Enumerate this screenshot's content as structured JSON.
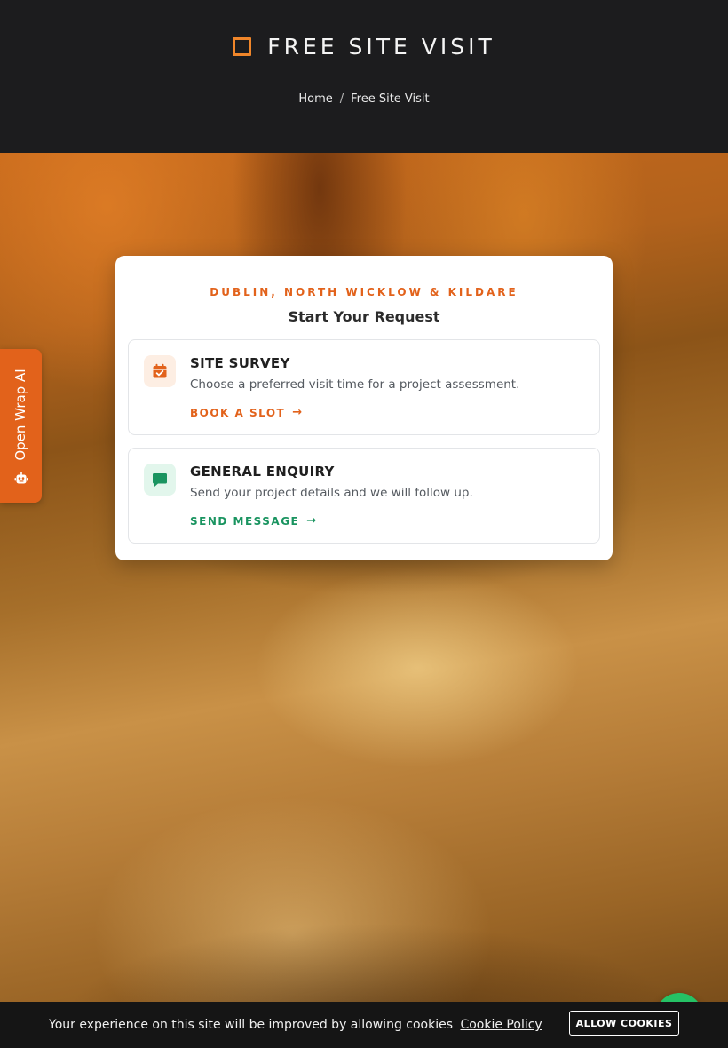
{
  "header": {
    "title": "FREE SITE VISIT",
    "breadcrumb": {
      "home": "Home",
      "separator": "/",
      "current": "Free Site Visit"
    }
  },
  "card": {
    "eyebrow": "DUBLIN, NORTH WICKLOW & KILDARE",
    "title": "Start Your Request",
    "options": [
      {
        "icon": "calendar-check-icon",
        "title": "SITE SURVEY",
        "description": "Choose a preferred visit time for a project assessment.",
        "link": "BOOK A SLOT",
        "accent": "#e2621b"
      },
      {
        "icon": "chat-bubble-icon",
        "title": "GENERAL ENQUIRY",
        "description": "Send your project details and we will follow up.",
        "link": "SEND MESSAGE",
        "accent": "#1a9460"
      }
    ]
  },
  "side_tab": {
    "label": "Open Wrap AI",
    "icon": "robot-icon"
  },
  "cookie_bar": {
    "text": "Your experience on this site will be improved by allowing cookies",
    "policy_link": "Cookie Policy",
    "button": "ALLOW COOKIES"
  },
  "colors": {
    "accent_orange": "#e2621b",
    "accent_green": "#1a9460",
    "header_bg": "#1c1c1e"
  }
}
